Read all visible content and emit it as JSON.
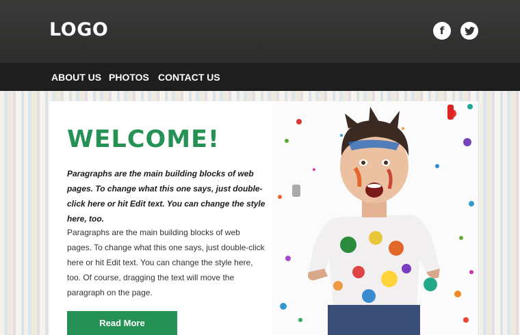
{
  "header": {
    "logo": "LOGO",
    "social": [
      {
        "name": "facebook",
        "icon": "facebook-icon",
        "glyph": "f"
      },
      {
        "name": "twitter",
        "icon": "twitter-icon"
      }
    ]
  },
  "nav": {
    "items": [
      "ABOUT US",
      "PHOTOS",
      "CONTACT US"
    ]
  },
  "main": {
    "title": "WELCOME!",
    "intro": "Paragraphs are the main building blocks of web pages. To change what this one says, just double-click here or hit Edit text. You can change the style here, too.",
    "body": "Paragraphs are the main building blocks of web pages. To change what this one says, just double-click here or hit Edit text. You can change the style here, too. Of course, dragging the text will move the paragraph on the page.",
    "button_label": "Read More",
    "image_alt": "paint-splattered-child-photo"
  },
  "colors": {
    "accent": "#259155",
    "header_bg": "#333332",
    "nav_bg": "#1e1e1e"
  }
}
